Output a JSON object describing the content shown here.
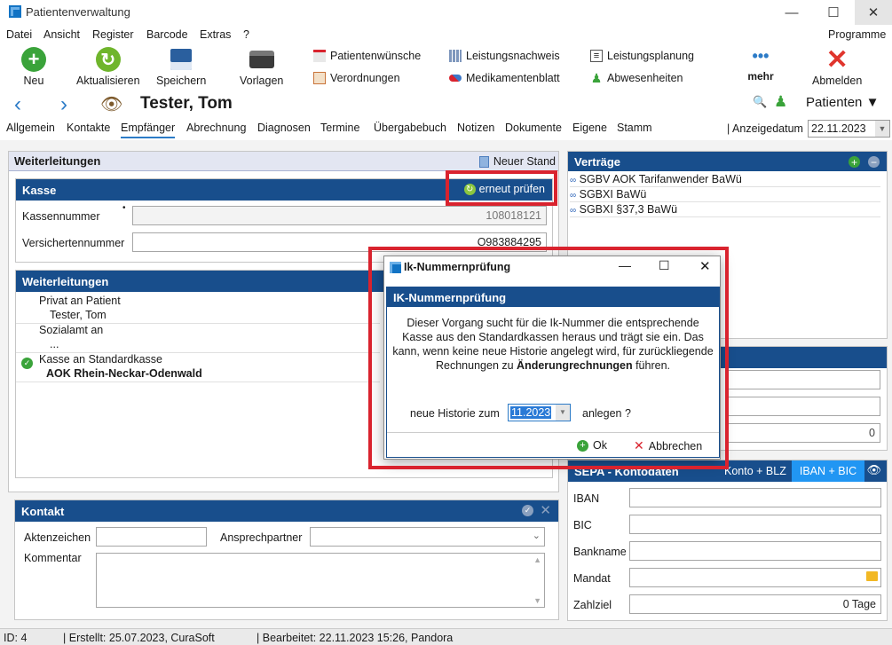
{
  "window": {
    "title": "Patientenverwaltung",
    "min": "—",
    "max": "☐",
    "close": "✕"
  },
  "menu": [
    "Datei",
    "Ansicht",
    "Register",
    "Barcode",
    "Extras",
    "?"
  ],
  "menu_right": "Programme",
  "toolbar": {
    "neu": "Neu",
    "aktualisieren": "Aktualisieren",
    "speichern": "Speichern",
    "vorlagen": "Vorlagen",
    "patientenwuensche": "Patientenwünsche",
    "verordnungen": "Verordnungen",
    "leistungsnachweis": "Leistungsnachweis",
    "medikamentenblatt": "Medikamentenblatt",
    "leistungsplanung": "Leistungsplanung",
    "abwesenheiten": "Abwesenheiten",
    "mehr": "mehr",
    "abmelden": "Abmelden"
  },
  "nav": {
    "patient_name": "Tester, Tom",
    "patienten_label": "Patienten"
  },
  "tabs": [
    "Allgemein",
    "Kontakte",
    "Empfänger",
    "Abrechnung",
    "Diagnosen",
    "Termine",
    "Übergabebuch",
    "Notizen",
    "Dokumente",
    "Eigene",
    "Stamm"
  ],
  "active_tab": "Empfänger",
  "anzeigedatum": {
    "label": "Anzeigedatum",
    "value": "22.11.2023"
  },
  "weiterleitungen_panel": {
    "title": "Weiterleitungen",
    "neuer_stand": "Neuer Stand"
  },
  "kasse": {
    "title": "Kasse",
    "erneut_pruefen": "erneut prüfen",
    "kassennummer_label": "Kassennummer",
    "kassennummer": "108018121",
    "versichertennummer_label": "Versichertennummer",
    "versichertennummer": "O983884295"
  },
  "weiterleitungen": {
    "title": "Weiterleitungen",
    "items": [
      {
        "label": "Privat an Patient",
        "value": "Tester, Tom"
      },
      {
        "label": "Sozialamt an",
        "value": "..."
      },
      {
        "label": "Kasse an Standardkasse",
        "value": "AOK Rhein-Neckar-Odenwald"
      }
    ]
  },
  "kontakt": {
    "title": "Kontakt",
    "aktenzeichen_label": "Aktenzeichen",
    "ansprechpartner_label": "Ansprechpartner",
    "kommentar_label": "Kommentar"
  },
  "vertraege": {
    "title": "Verträge",
    "items": [
      "SGBV AOK Tarifanwender BaWü",
      "SGBXI BaWü",
      "SGBXI §37,3 BaWü"
    ]
  },
  "right_mid": {
    "value3": "0"
  },
  "sepa": {
    "title": "SEPA - Kontodaten",
    "konto_blz": "Konto + BLZ",
    "iban_bic": "IBAN + BIC",
    "iban_label": "IBAN",
    "bic_label": "BIC",
    "bankname_label": "Bankname",
    "mandat_label": "Mandat",
    "zahlziel_label": "Zahlziel",
    "zahlziel": "0 Tage"
  },
  "dialog": {
    "title": "Ik-Nummernprüfung",
    "header": "IK-Nummernprüfung",
    "text1": "Dieser Vorgang sucht für die Ik-Nummer die entsprechende Kasse aus den Standardkassen heraus und trägt sie ein. Das kann, wenn keine neue Historie angelegt wird, für zurückliegende Rechnungen zu ",
    "text_bold": "Änderungrechnungen",
    "text2": " führen.",
    "historie_label": "neue Historie zum",
    "historie_value": "11.2023",
    "anlegen": "anlegen ?",
    "ok": "Ok",
    "abbrechen": "Abbrechen"
  },
  "status": {
    "id": "ID: 4",
    "erstellt": "Erstellt: 25.07.2023, CuraSoft",
    "bearbeitet": "Bearbeitet: 22.11.2023 15:26, Pandora"
  },
  "colors": {
    "accent_blue": "#184e8c",
    "highlight": "#d9232e",
    "green": "#3aa33a"
  }
}
